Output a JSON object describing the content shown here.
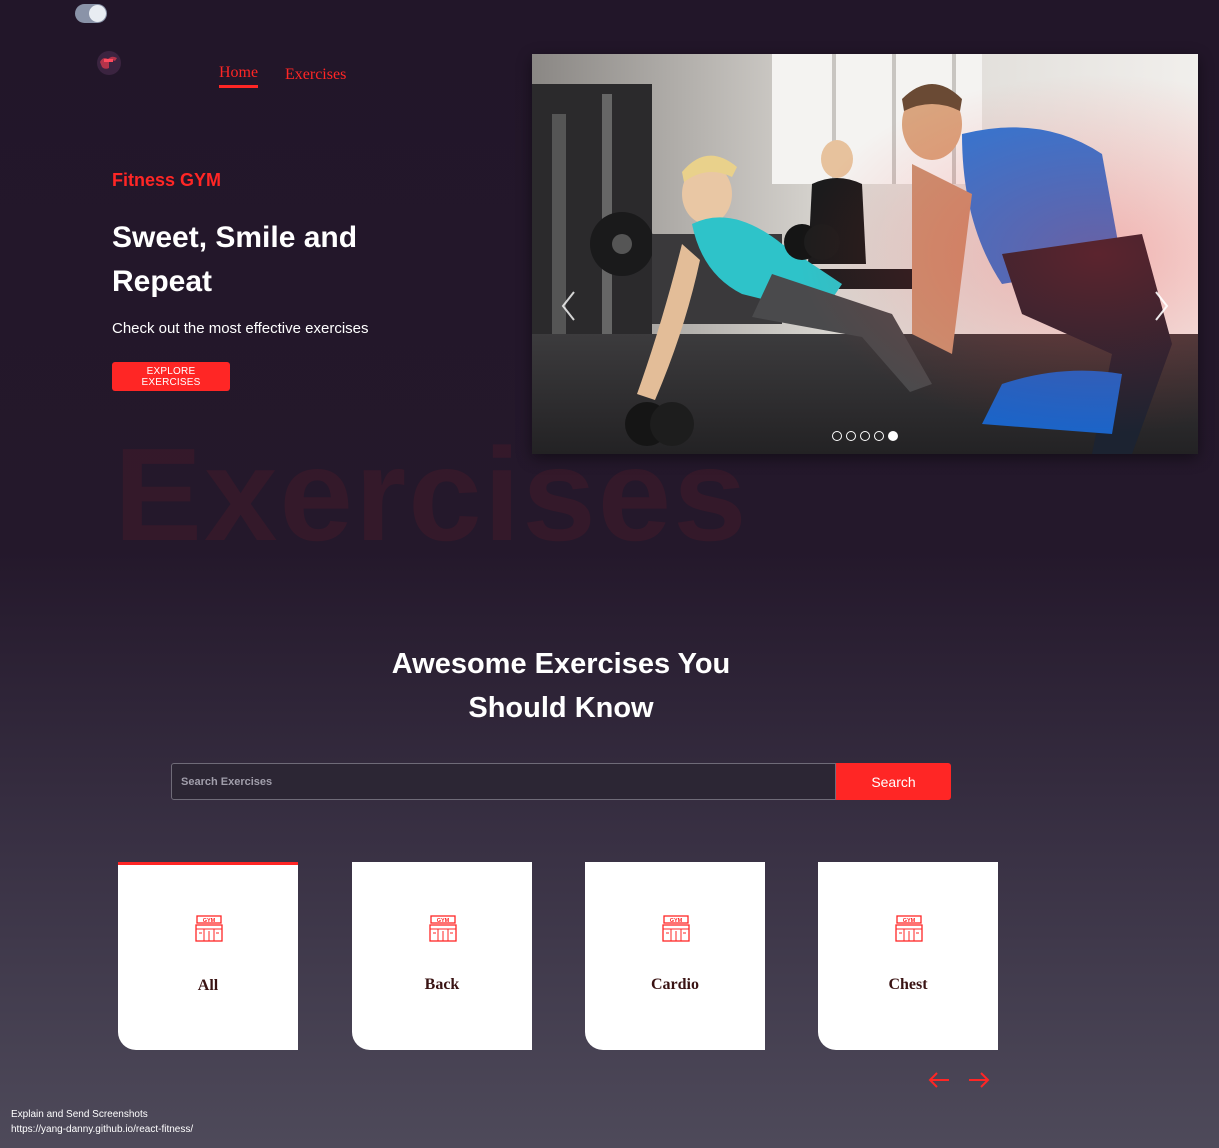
{
  "nav": {
    "home_label": "Home",
    "exercises_label": "Exercises"
  },
  "hero": {
    "brand": "Fitness GYM",
    "title": "Sweet, Smile and Repeat",
    "subtitle": "Check out the most effective exercises",
    "button_label": "EXPLORE EXERCISES",
    "watermark": "Exercises"
  },
  "carousel": {
    "slide_count": 5,
    "active_slide": 5
  },
  "section": {
    "title": "Awesome Exercises You Should Know",
    "search_placeholder": "Search Exercises",
    "search_button": "Search"
  },
  "categories": [
    {
      "label": "All",
      "active": true
    },
    {
      "label": "Back",
      "active": false
    },
    {
      "label": "Cardio",
      "active": false
    },
    {
      "label": "Chest",
      "active": false
    }
  ],
  "overlay": {
    "line1": "Explain and Send Screenshots",
    "line2": "https://yang-danny.github.io/react-fitness/"
  },
  "colors": {
    "accent": "#ff2625",
    "background": "#221629",
    "card": "#ffffff"
  },
  "icons": [
    "theme-toggle-icon",
    "logo-icon",
    "chevron-left-icon",
    "chevron-right-icon",
    "gym-icon",
    "arrow-left-icon",
    "arrow-right-icon"
  ]
}
